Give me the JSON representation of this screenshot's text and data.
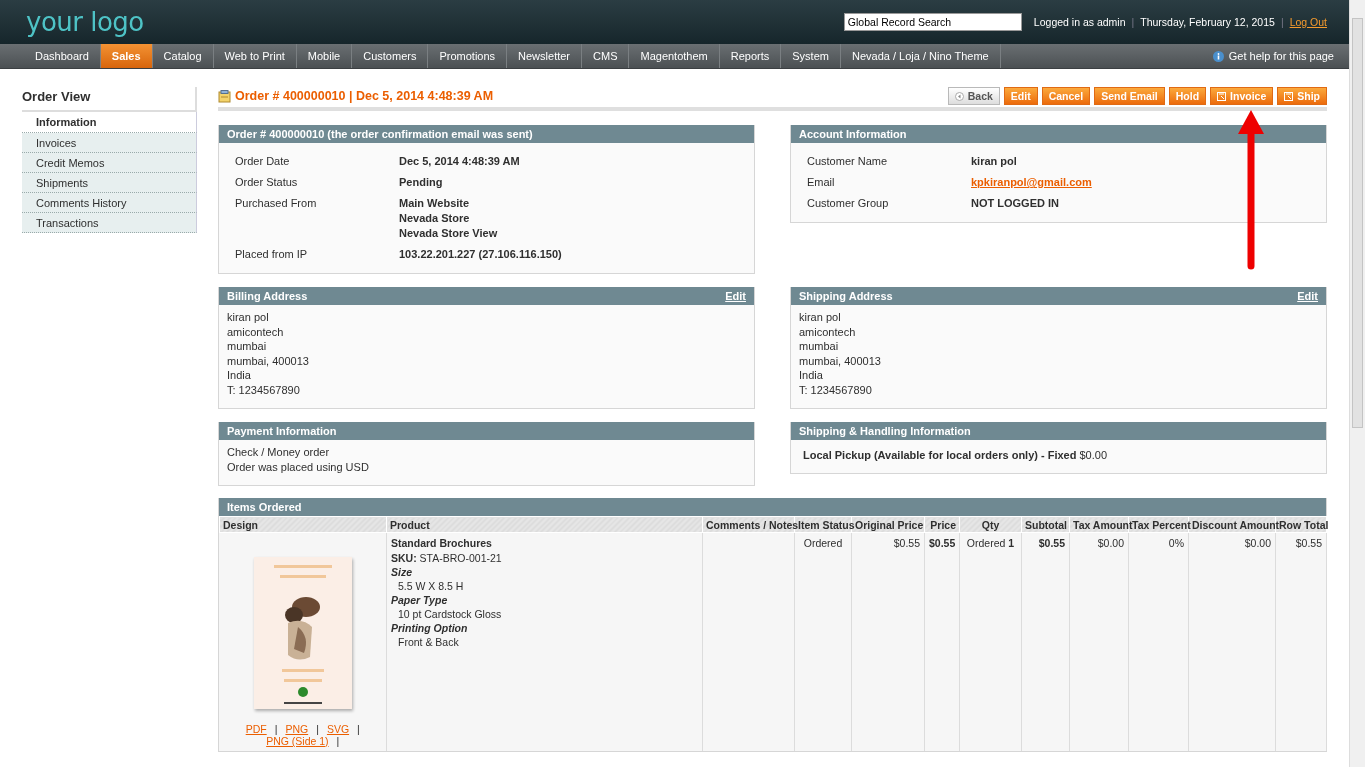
{
  "header": {
    "logo": "your logo",
    "search": {
      "value": "Global Record Search"
    },
    "separator": "|",
    "logged_in": "Logged in as admin",
    "date": "Thursday, February 12, 2015",
    "logout": "Log Out"
  },
  "nav": {
    "items": [
      {
        "label": "Dashboard",
        "selected": false
      },
      {
        "label": "Sales",
        "selected": true
      },
      {
        "label": "Catalog",
        "selected": false
      },
      {
        "label": "Web to Print",
        "selected": false
      },
      {
        "label": "Mobile",
        "selected": false
      },
      {
        "label": "Customers",
        "selected": false
      },
      {
        "label": "Promotions",
        "selected": false
      },
      {
        "label": "Newsletter",
        "selected": false
      },
      {
        "label": "CMS",
        "selected": false
      },
      {
        "label": "Magentothem",
        "selected": false
      },
      {
        "label": "Reports",
        "selected": false
      },
      {
        "label": "System",
        "selected": false
      },
      {
        "label": "Nevada / Loja / Nino Theme",
        "selected": false
      }
    ],
    "help": "Get help for this page"
  },
  "sidebar": {
    "title": "Order View",
    "items": [
      {
        "label": "Information",
        "selected": true
      },
      {
        "label": "Invoices",
        "selected": false
      },
      {
        "label": "Credit Memos",
        "selected": false
      },
      {
        "label": "Shipments",
        "selected": false
      },
      {
        "label": "Comments History",
        "selected": false
      },
      {
        "label": "Transactions",
        "selected": false
      }
    ]
  },
  "page_title": "Order # 400000010 | Dec 5, 2014 4:48:39 AM",
  "buttons": [
    {
      "label": "Back",
      "kind": "back"
    },
    {
      "label": "Edit",
      "kind": "action"
    },
    {
      "label": "Cancel",
      "kind": "action"
    },
    {
      "label": "Send Email",
      "kind": "action"
    },
    {
      "label": "Hold",
      "kind": "action"
    },
    {
      "label": "Invoice",
      "kind": "icon"
    },
    {
      "label": "Ship",
      "kind": "icon"
    }
  ],
  "order_info": {
    "title": "Order # 400000010 (the order confirmation email was sent)",
    "rows": [
      {
        "label": "Order Date",
        "values": [
          "Dec 5, 2014 4:48:39 AM"
        ]
      },
      {
        "label": "Order Status",
        "values": [
          "Pending"
        ]
      },
      {
        "label": "Purchased From",
        "values": [
          "Main Website",
          "Nevada Store",
          "Nevada Store View"
        ]
      },
      {
        "label": "Placed from IP",
        "values": [
          "103.22.201.227 (27.106.116.150)"
        ]
      }
    ]
  },
  "account": {
    "title": "Account Information",
    "rows": [
      {
        "label": "Customer Name",
        "value": "kiran pol",
        "kind": "text"
      },
      {
        "label": "Email",
        "value": "kpkiranpol@gmail.com",
        "kind": "link"
      },
      {
        "label": "Customer Group",
        "value": "NOT LOGGED IN",
        "kind": "text"
      }
    ]
  },
  "billing": {
    "title": "Billing Address",
    "edit": "Edit",
    "lines": [
      "kiran pol",
      "amicontech",
      "mumbai",
      "mumbai, 400013",
      "India",
      "T: 1234567890"
    ]
  },
  "shipping": {
    "title": "Shipping Address",
    "edit": "Edit",
    "lines": [
      "kiran pol",
      "amicontech",
      "mumbai",
      "mumbai, 400013",
      "India",
      "T: 1234567890"
    ]
  },
  "payment": {
    "title": "Payment Information",
    "lines": [
      "Check / Money order",
      "Order was placed using USD"
    ]
  },
  "shipping_method": {
    "title": "Shipping & Handling Information",
    "text": "**Local Pickup (Available for local orders only) - Fixed** $0.00"
  },
  "items": {
    "title": "Items Ordered",
    "columns": [
      "Design",
      "Product",
      "Comments / Notes",
      "Item Status",
      "Original Price",
      "Price",
      "Qty",
      "Subtotal",
      "Tax Amount",
      "Tax Percent",
      "Discount Amount",
      "Row Total"
    ],
    "row": {
      "design": {
        "kind": "picture",
        "separator": "|",
        "links": [
          "PDF",
          "PNG",
          "SVG",
          "PNG (Side 1)"
        ]
      },
      "product": {
        "name": "Standard Brochures",
        "sku_label": "SKU:",
        "sku": "STA-BRO-001-21",
        "options": [
          {
            "label": "Size",
            "value": "5.5 W X 8.5 H"
          },
          {
            "label": "Paper Type",
            "value": "10 pt Cardstock Gloss"
          },
          {
            "label": "Printing Option",
            "value": "Front & Back"
          }
        ]
      },
      "status": "Ordered",
      "original_price": "$0.55",
      "price": "$0.55",
      "qty_status": "Ordered",
      "qty": "1",
      "subtotal": "$0.55",
      "tax_amount": "$0.00",
      "tax_percent": "0%",
      "discount": "$0.00",
      "row_total": "$0.55"
    }
  }
}
